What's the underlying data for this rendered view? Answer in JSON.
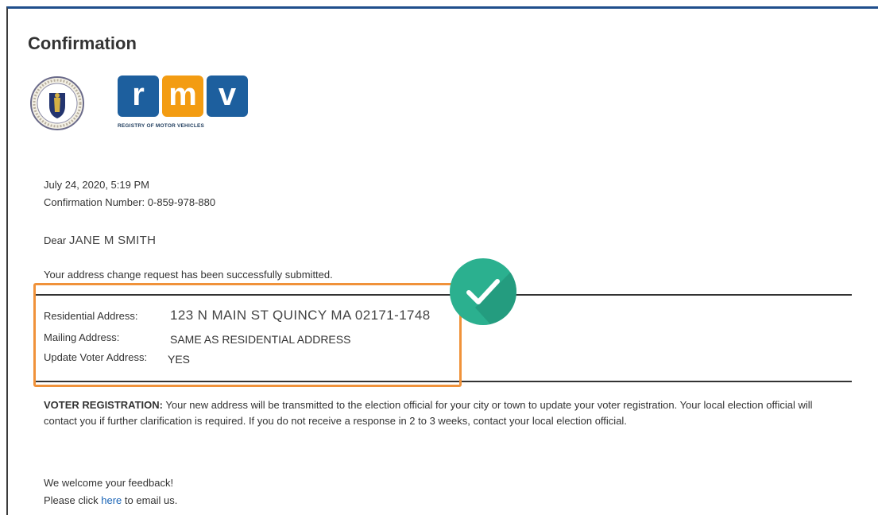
{
  "page": {
    "title": "Confirmation"
  },
  "logos": {
    "rmv_letters": [
      "r",
      "m",
      "v"
    ],
    "rmv_tagline": "REGISTRY OF MOTOR VEHICLES",
    "colors": {
      "r": "#1d5f9e",
      "m": "#f39c12",
      "v": "#1d5f9e",
      "check_bg": "#2bb08f",
      "highlight_border": "#f0923a",
      "link": "#1a64b6"
    }
  },
  "meta": {
    "datetime": "July 24, 2020, 5:19 PM",
    "confirmation_label": "Confirmation Number:",
    "confirmation_number": "0-859-978-880"
  },
  "greeting": {
    "salutation": "Dear",
    "name": "JANE M SMITH"
  },
  "status_message": "Your address change request has been successfully submitted.",
  "details": {
    "residential_label": "Residential Address:",
    "residential_value": "123 N MAIN ST QUINCY MA 02171-1748",
    "mailing_label": "Mailing Address:",
    "mailing_value": "SAME AS RESIDENTIAL ADDRESS",
    "voter_label": "Update Voter Address:",
    "voter_value": "YES"
  },
  "voter_registration": {
    "heading": "VOTER REGISTRATION:",
    "body": "Your new address will be transmitted to the election official for your city or town to update your voter registration. Your local election official will contact you if further clarification is required. If you do not receive a response in 2 to 3 weeks, contact your local election official."
  },
  "feedback": {
    "line1": "We welcome your feedback!",
    "prefix": "Please click",
    "link_text": "here",
    "suffix": "to email us."
  },
  "icons": {
    "seal": "massachusetts-seal-icon",
    "check": "checkmark-icon"
  }
}
